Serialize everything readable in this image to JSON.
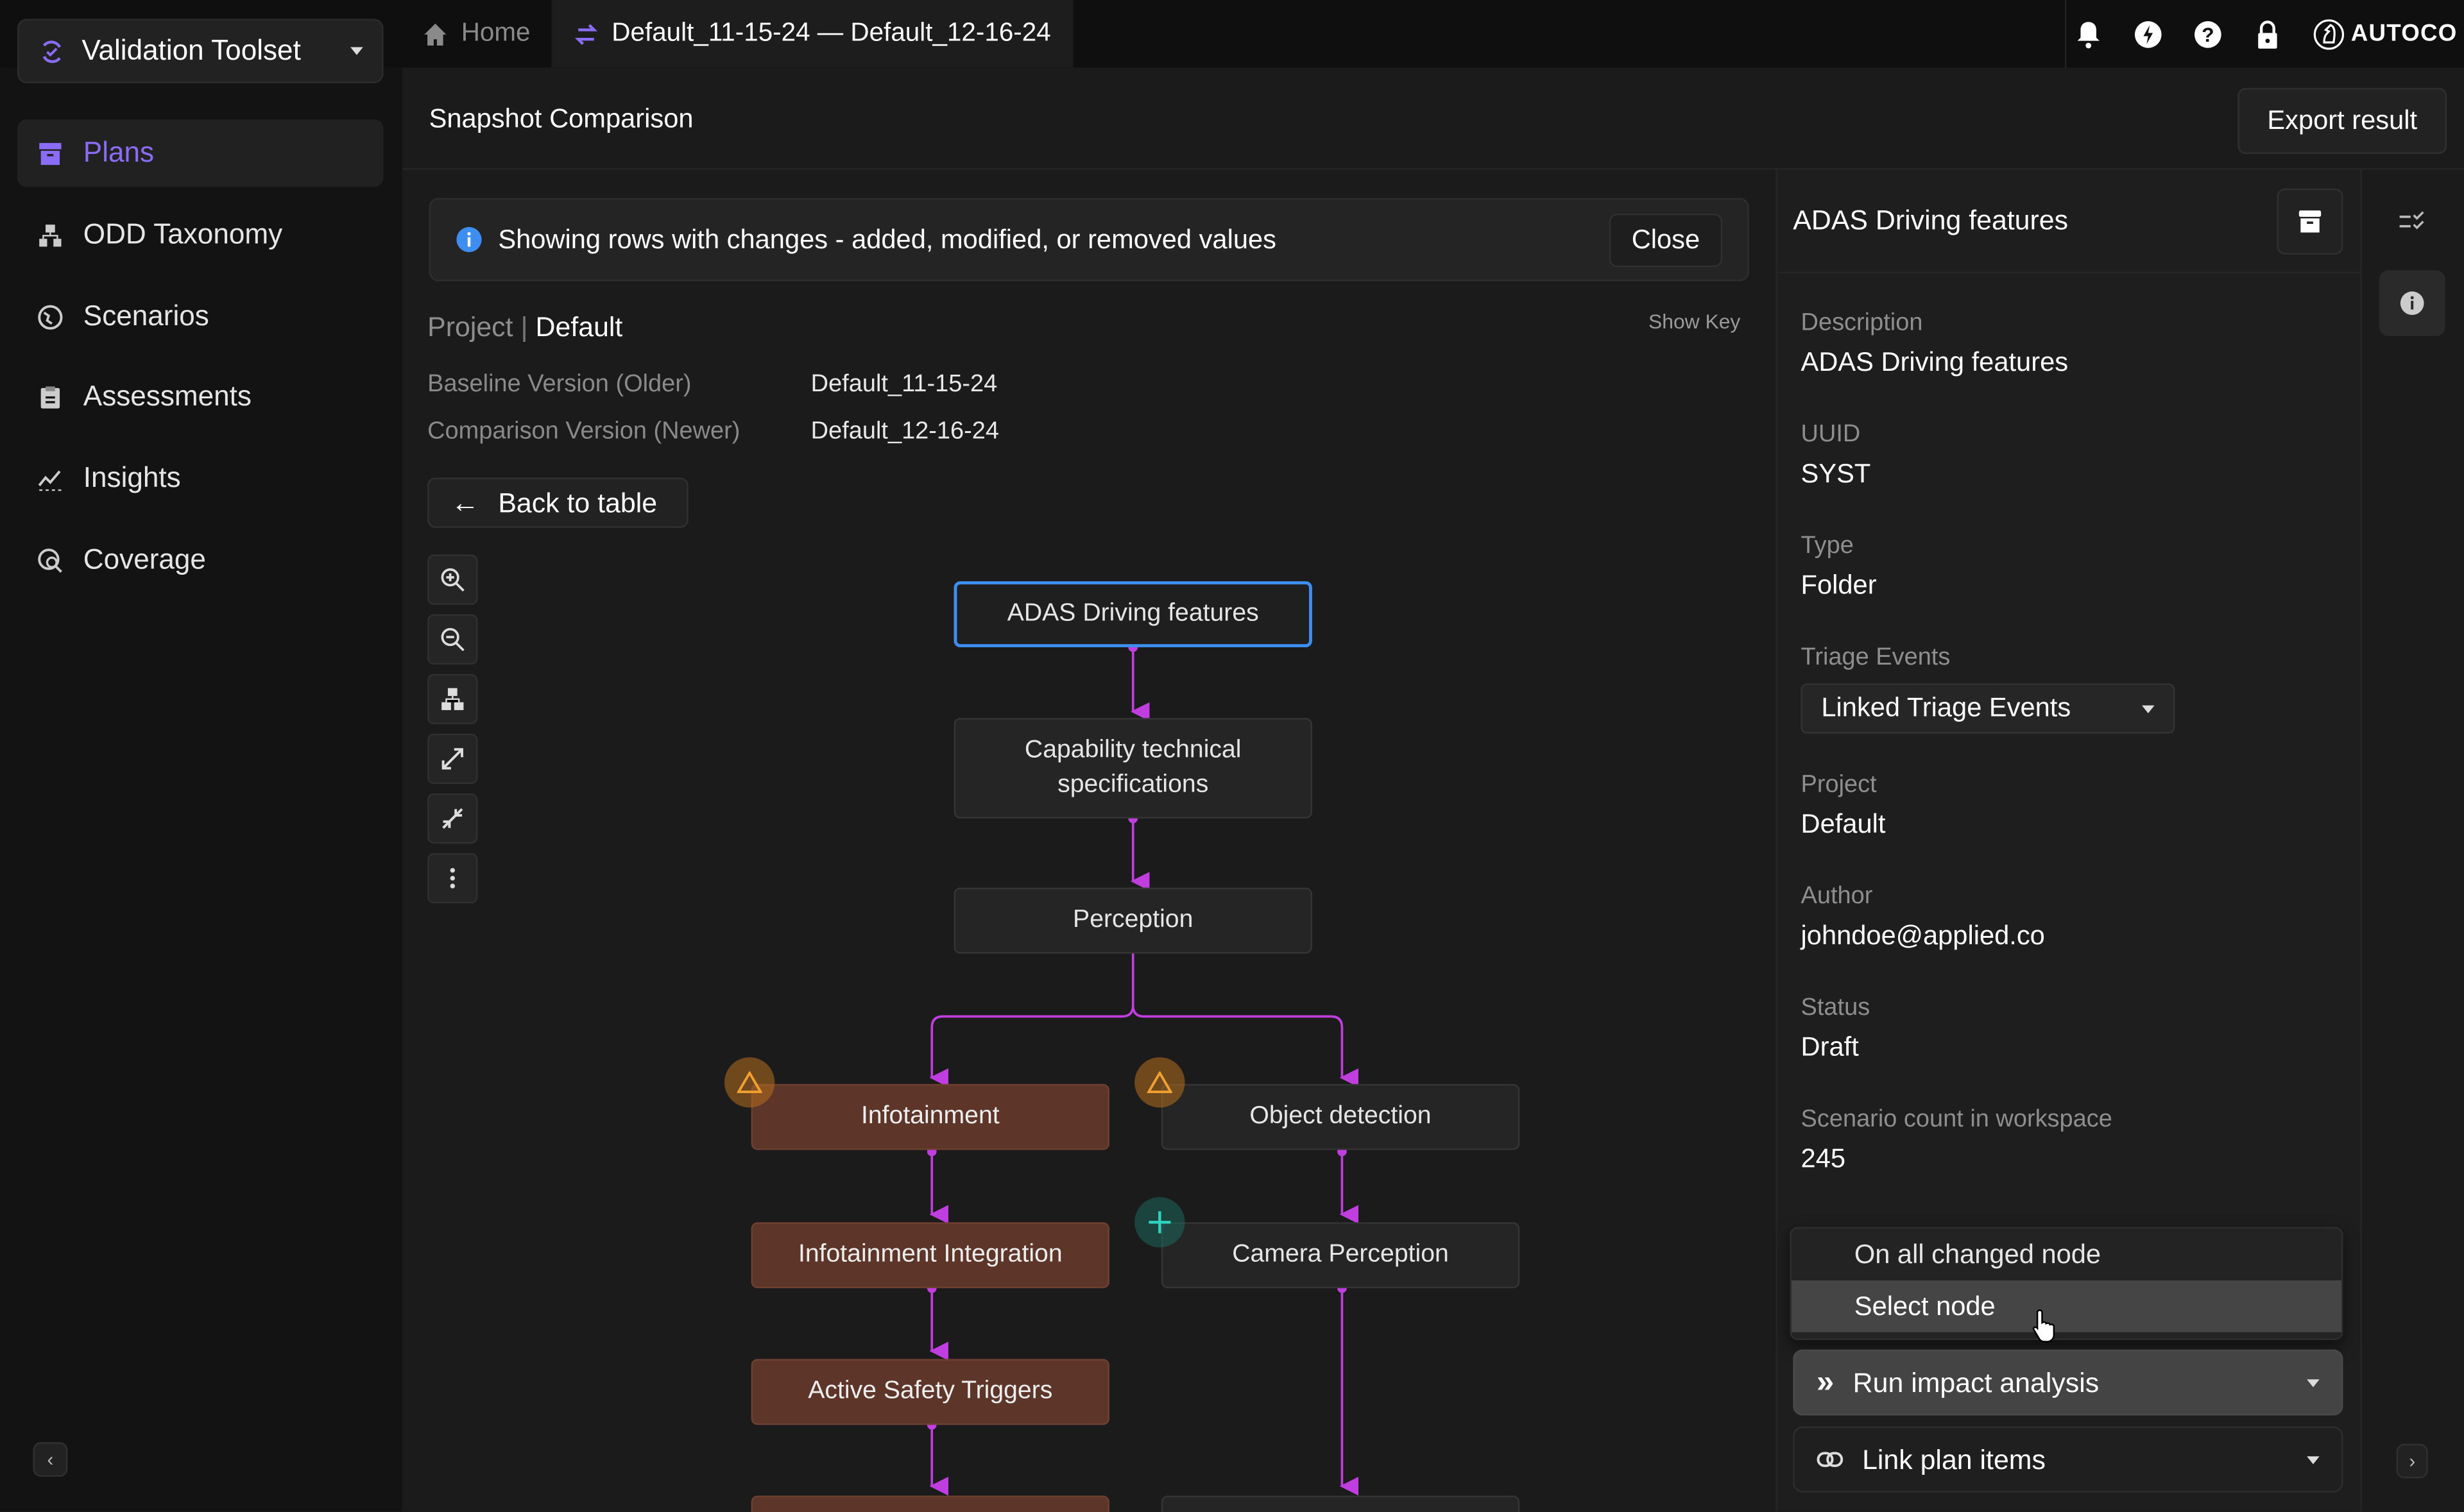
{
  "app": {
    "toolset_label": "Validation Toolset",
    "brand": "AUTOCO"
  },
  "sidebar": {
    "items": [
      {
        "label": "Plans",
        "icon": "plans-icon",
        "active": true
      },
      {
        "label": "ODD Taxonomy",
        "icon": "taxonomy-icon"
      },
      {
        "label": "Scenarios",
        "icon": "globe-icon"
      },
      {
        "label": "Assessments",
        "icon": "clipboard-icon"
      },
      {
        "label": "Insights",
        "icon": "insights-icon"
      },
      {
        "label": "Coverage",
        "icon": "coverage-icon"
      }
    ]
  },
  "tabs": {
    "home": "Home",
    "active": "Default_11-15-24 — Default_12-16-24"
  },
  "header": {
    "title": "Snapshot Comparison",
    "export_label": "Export result"
  },
  "banner": {
    "text": "Showing rows with changes - added, modified, or removed values",
    "close_label": "Close"
  },
  "project": {
    "label": "Project",
    "value": "Default",
    "show_key": "Show Key"
  },
  "versions": {
    "baseline_label": "Baseline Version (Older)",
    "baseline_value": "Default_11-15-24",
    "comparison_label": "Comparison Version (Newer)",
    "comparison_value": "Default_12-16-24"
  },
  "back_label": "Back to table",
  "graph": {
    "nodes": [
      {
        "id": "adas",
        "label": "ADAS Driving features",
        "status": "selected"
      },
      {
        "id": "cap",
        "label": "Capability technical specifications",
        "status": "unchanged"
      },
      {
        "id": "perc",
        "label": "Perception",
        "status": "unchanged"
      },
      {
        "id": "info",
        "label": "Infotainment",
        "status": "modified"
      },
      {
        "id": "obj",
        "label": "Object detection",
        "status": "modified-child"
      },
      {
        "id": "infoint",
        "label": "Infotainment Integration",
        "status": "modified"
      },
      {
        "id": "cam",
        "label": "Camera Perception",
        "status": "added"
      },
      {
        "id": "safety",
        "label": "Active Safety Triggers",
        "status": "modified"
      }
    ]
  },
  "panel": {
    "title": "ADAS Driving features",
    "fields": [
      {
        "key": "Description",
        "value": "ADAS Driving features"
      },
      {
        "key": "UUID",
        "value": "SYST"
      },
      {
        "key": "Type",
        "value": "Folder"
      },
      {
        "key": "Triage Events",
        "value": "Linked Triage Events"
      },
      {
        "key": "Project",
        "value": "Default"
      },
      {
        "key": "Author",
        "value": "johndoe@applied.co"
      },
      {
        "key": "Status",
        "value": "Draft"
      },
      {
        "key": "Scenario count in workspace",
        "value": "245"
      }
    ],
    "menu": [
      "On all changed node",
      "Select node"
    ],
    "run_label": "Run impact analysis",
    "link_label": "Link plan items"
  },
  "colors": {
    "accent": "#8b6cf6",
    "edge": "#c03ee0",
    "modified": "#5e3529",
    "selected": "#3d8ef0",
    "warn": "#f0a030",
    "add": "#2fd3c0"
  }
}
